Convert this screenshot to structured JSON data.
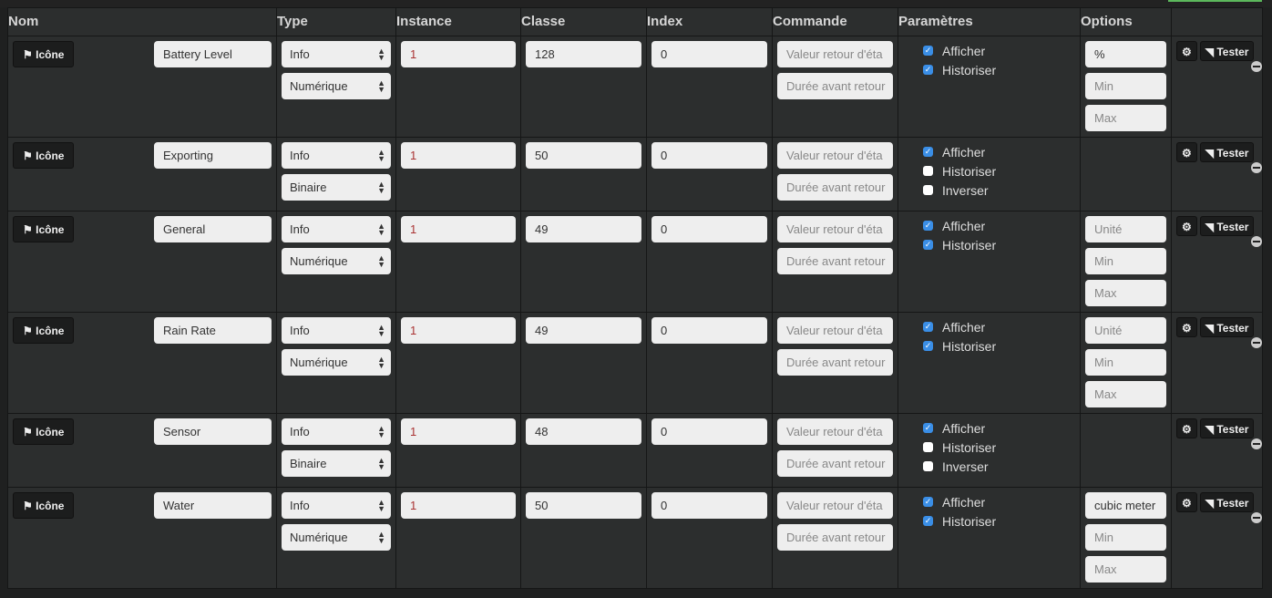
{
  "headers": {
    "nom": "Nom",
    "type": "Type",
    "instance": "Instance",
    "classe": "Classe",
    "index": "Index",
    "commande": "Commande",
    "parametres": "Paramètres",
    "options": "Options"
  },
  "labels": {
    "icon_button": "Icône",
    "tester_button": "Tester",
    "cmd_value_placeholder": "Valeur retour d'éta",
    "cmd_delay_placeholder": "Durée avant retour",
    "afficher": "Afficher",
    "historiser": "Historiser",
    "inverser": "Inverser",
    "min_placeholder": "Min",
    "max_placeholder": "Max",
    "unit_placeholder": "Unité"
  },
  "colors": {
    "accent": "#5cb85c",
    "checkbox": "#3a8ee6"
  },
  "rows": [
    {
      "name": "Battery Level",
      "type": "Info",
      "subtype": "Numérique",
      "instance": "1",
      "classe": "128",
      "index": "0",
      "afficher": true,
      "historiser": true,
      "unit": "%"
    },
    {
      "name": "Exporting",
      "type": "Info",
      "subtype": "Binaire",
      "instance": "1",
      "classe": "50",
      "index": "0",
      "afficher": true,
      "historiser": false,
      "inverser": false
    },
    {
      "name": "General",
      "type": "Info",
      "subtype": "Numérique",
      "instance": "1",
      "classe": "49",
      "index": "0",
      "afficher": true,
      "historiser": true,
      "unit": ""
    },
    {
      "name": "Rain Rate",
      "type": "Info",
      "subtype": "Numérique",
      "instance": "1",
      "classe": "49",
      "index": "0",
      "afficher": true,
      "historiser": true,
      "unit": ""
    },
    {
      "name": "Sensor",
      "type": "Info",
      "subtype": "Binaire",
      "instance": "1",
      "classe": "48",
      "index": "0",
      "afficher": true,
      "historiser": false,
      "inverser": false
    },
    {
      "name": "Water",
      "type": "Info",
      "subtype": "Numérique",
      "instance": "1",
      "classe": "50",
      "index": "0",
      "afficher": true,
      "historiser": true,
      "unit": "cubic meter"
    }
  ]
}
